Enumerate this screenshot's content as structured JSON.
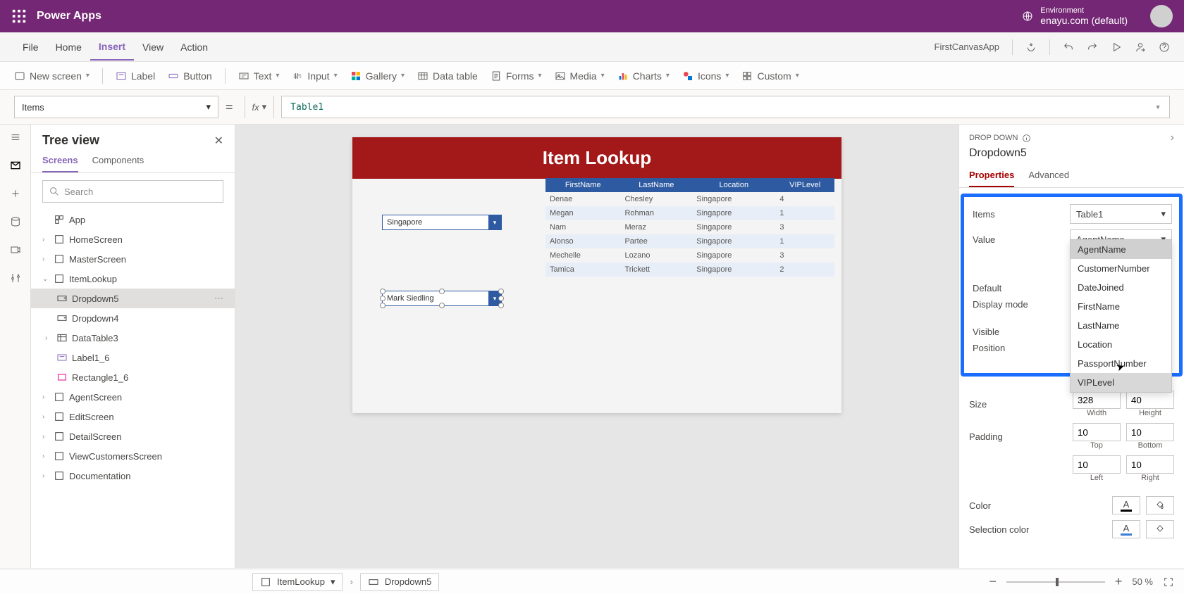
{
  "topbar": {
    "app": "Power Apps",
    "env_label": "Environment",
    "env_name": "enayu.com (default)"
  },
  "menus": {
    "file": "File",
    "home": "Home",
    "insert": "Insert",
    "view": "View",
    "action": "Action",
    "app_name": "FirstCanvasApp"
  },
  "ribbon": {
    "newscreen": "New screen",
    "label": "Label",
    "button": "Button",
    "text": "Text",
    "input": "Input",
    "gallery": "Gallery",
    "datatable": "Data table",
    "forms": "Forms",
    "media": "Media",
    "charts": "Charts",
    "icons": "Icons",
    "custom": "Custom"
  },
  "formula": {
    "property": "Items",
    "fx": "fx",
    "value": "Table1"
  },
  "tree": {
    "title": "Tree view",
    "tab_screens": "Screens",
    "tab_components": "Components",
    "search_placeholder": "Search",
    "app": "App",
    "items": [
      {
        "n": "HomeScreen"
      },
      {
        "n": "MasterScreen"
      },
      {
        "n": "ItemLookup"
      },
      {
        "n": "AgentScreen"
      },
      {
        "n": "EditScreen"
      },
      {
        "n": "DetailScreen"
      },
      {
        "n": "ViewCustomersScreen"
      },
      {
        "n": "Documentation"
      }
    ],
    "lookup_children": [
      {
        "n": "Dropdown5",
        "sel": true
      },
      {
        "n": "Dropdown4"
      },
      {
        "n": "DataTable3"
      },
      {
        "n": "Label1_6"
      },
      {
        "n": "Rectangle1_6"
      }
    ]
  },
  "canvas": {
    "title": "Item Lookup",
    "dd1_value": "Singapore",
    "dd2_value": "Mark Siedling",
    "table": {
      "cols": [
        "FirstName",
        "LastName",
        "Location",
        "VIPLevel"
      ],
      "rows": [
        [
          "Denae",
          "Chesley",
          "Singapore",
          "4"
        ],
        [
          "Megan",
          "Rohman",
          "Singapore",
          "1"
        ],
        [
          "Nam",
          "Meraz",
          "Singapore",
          "3"
        ],
        [
          "Alonso",
          "Partee",
          "Singapore",
          "1"
        ],
        [
          "Mechelle",
          "Lozano",
          "Singapore",
          "3"
        ],
        [
          "Tamica",
          "Trickett",
          "Singapore",
          "2"
        ]
      ]
    }
  },
  "props": {
    "type": "DROP DOWN",
    "name": "Dropdown5",
    "tab_props": "Properties",
    "tab_adv": "Advanced",
    "rows": {
      "items_label": "Items",
      "items_val": "Table1",
      "value_label": "Value",
      "value_val": "AgentName",
      "default_label": "Default",
      "display_label": "Display mode",
      "visible_label": "Visible",
      "position_label": "Position",
      "size_label": "Size",
      "size_w": "328",
      "size_h": "40",
      "size_w_lbl": "Width",
      "size_h_lbl": "Height",
      "padding_label": "Padding",
      "pad_top": "10",
      "pad_bottom": "10",
      "pad_left": "10",
      "pad_right": "10",
      "pad_top_lbl": "Top",
      "pad_bottom_lbl": "Bottom",
      "pad_left_lbl": "Left",
      "pad_right_lbl": "Right",
      "color_label": "Color",
      "sel_color_label": "Selection color"
    },
    "value_options": [
      "AgentName",
      "CustomerNumber",
      "DateJoined",
      "FirstName",
      "LastName",
      "Location",
      "PassportNumber",
      "VIPLevel"
    ]
  },
  "status": {
    "crumb1": "ItemLookup",
    "crumb2": "Dropdown5",
    "zoom": "50 %"
  }
}
